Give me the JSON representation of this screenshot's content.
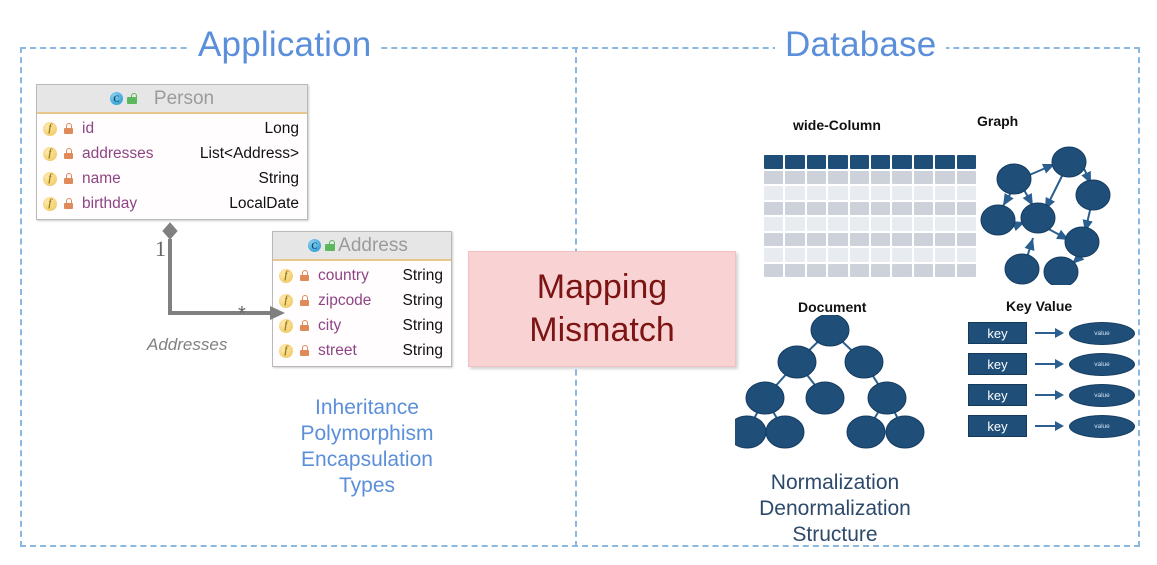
{
  "zones": {
    "application_title": "Application",
    "database_title": "Database"
  },
  "uml": {
    "person": {
      "title": "Person",
      "class_icon": "C",
      "fields": [
        {
          "icon": "f",
          "name": "id",
          "type": "Long"
        },
        {
          "icon": "f",
          "name": "addresses",
          "type": "List<Address>"
        },
        {
          "icon": "f",
          "name": "name",
          "type": "String"
        },
        {
          "icon": "f",
          "name": "birthday",
          "type": "LocalDate"
        }
      ]
    },
    "address": {
      "title": "Address",
      "class_icon": "C",
      "fields": [
        {
          "icon": "f",
          "name": "country",
          "type": "String"
        },
        {
          "icon": "f",
          "name": "zipcode",
          "type": "String"
        },
        {
          "icon": "f",
          "name": "city",
          "type": "String"
        },
        {
          "icon": "f",
          "name": "street",
          "type": "String"
        }
      ]
    }
  },
  "association": {
    "source_multiplicity": "1",
    "target_multiplicity": "*",
    "role_label": "Addresses"
  },
  "mismatch": {
    "line1": "Mapping",
    "line2": "Mismatch"
  },
  "oo_concepts": [
    "Inheritance",
    "Polymorphism",
    "Encapsulation",
    "Types"
  ],
  "db_concepts": [
    "Normalization",
    "Denormalization",
    "Structure"
  ],
  "db_sections": {
    "wide_column": "wide-Column",
    "graph": "Graph",
    "document": "Document",
    "key_value": "Key Value"
  },
  "key_value_pairs": [
    {
      "key": "key",
      "value": "value"
    },
    {
      "key": "key",
      "value": "value"
    },
    {
      "key": "key",
      "value": "value"
    },
    {
      "key": "key",
      "value": "value"
    }
  ],
  "wide_column_grid": {
    "columns": 10,
    "header_rows": 1,
    "body_rows": 7
  },
  "colors": {
    "zone_border": "#8bb8e0",
    "zone_title": "#5b8fd9",
    "db_node": "#1f4e79",
    "mismatch_bg": "#f9d3d3",
    "mismatch_text": "#7d1414",
    "uml_field_name": "#8e4585",
    "uml_header_bg": "#e6e6e6",
    "grid_header": "#1f4e79",
    "grid_row_dark": "#cdd1da",
    "grid_row_light": "#e8ebf0",
    "assoc_line": "#808080"
  }
}
